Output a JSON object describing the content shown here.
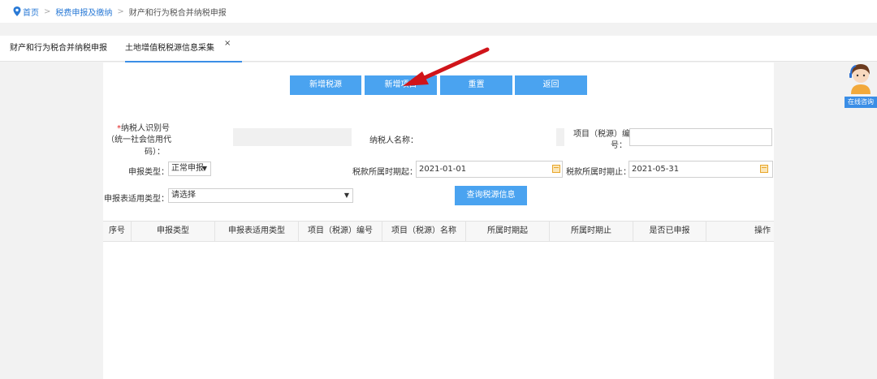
{
  "breadcrumb": {
    "home": "首页",
    "sep1": ">",
    "level2": "税费申报及缴纳",
    "sep2": ">",
    "current": "财产和行为税合并纳税申报"
  },
  "tabs": [
    {
      "label": "财产和行为税合并纳税申报"
    },
    {
      "label": "土地增值税税源信息采集",
      "close": "×"
    }
  ],
  "actions": {
    "add_tax_source": "新增税源",
    "add_project": "新增项目",
    "reset": "重置",
    "back": "返回"
  },
  "form": {
    "required_mark": "*",
    "taxpayer_id_label_1": "纳税人识别号",
    "taxpayer_id_label_2": "（统一社会信用代",
    "taxpayer_id_label_3": "码）：",
    "taxpayer_name_label": "纳税人名称：",
    "project_no_label_1": "项目（税源）编",
    "project_no_label_2": "号：",
    "declare_type_label": "申报类型：",
    "declare_type_value": "正常申报",
    "period_start_label": "税款所属时期起：",
    "period_start_value": "2021-01-01",
    "period_end_label": "税款所属时期止：",
    "period_end_value": "2021-05-31",
    "form_type_label": "申报表适用类型：",
    "form_type_value": "请选择",
    "query_button": "查询税源信息"
  },
  "table": {
    "columns": [
      "序号",
      "申报类型",
      "申报表适用类型",
      "项目（税源）编号",
      "项目（税源）名称",
      "所属时期起",
      "所属时期止",
      "是否已申报",
      "操作"
    ]
  },
  "consult": {
    "label": "在线咨询"
  },
  "colors": {
    "accent": "#4aa3f0",
    "link": "#2a7ad6",
    "annotation": "#d0141a"
  }
}
